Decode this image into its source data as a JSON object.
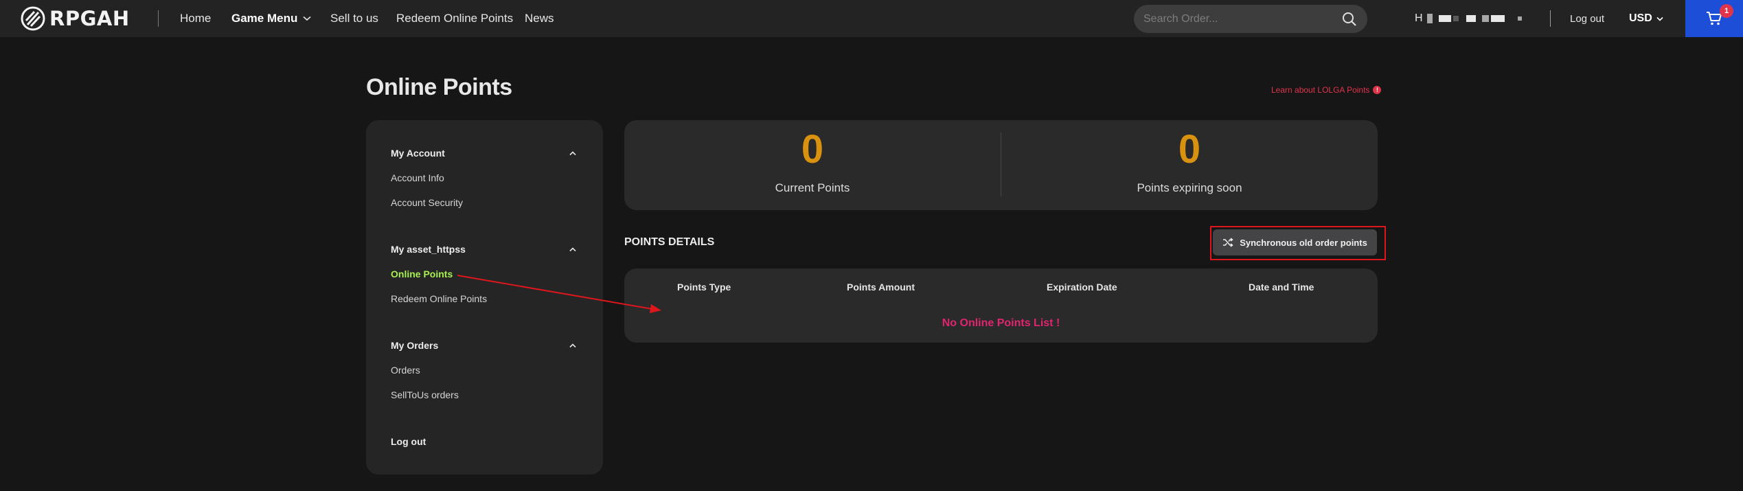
{
  "topbar": {
    "logo_text": "RPGAH",
    "nav": [
      {
        "label": "Home"
      },
      {
        "label": "Game Menu"
      },
      {
        "label": "Sell to us"
      },
      {
        "label": "Redeem Online Points"
      },
      {
        "label": "News"
      }
    ],
    "search_placeholder": "Search Order...",
    "user_initial": "H",
    "logout_label": "Log out",
    "currency": "USD",
    "cart_count": "1"
  },
  "page": {
    "title": "Online Points",
    "learn_link": "Learn about LOLGA Points",
    "learn_icon": "!"
  },
  "sidebar": {
    "groups": [
      {
        "title": "My Account",
        "items": [
          "Account Info",
          "Account Security"
        ]
      },
      {
        "title": "My asset_httpss",
        "items": [
          "Online Points",
          "Redeem Online Points"
        ]
      },
      {
        "title": "My Orders",
        "items": [
          "Orders",
          "SellToUs orders"
        ]
      }
    ],
    "active_item": "Online Points",
    "logout_label": "Log out"
  },
  "stats": {
    "current_points": "0",
    "current_points_label": "Current Points",
    "expiring_points": "0",
    "expiring_points_label": "Points expiring soon"
  },
  "details": {
    "title": "POINTS DETAILS",
    "sync_label": "Synchronous old order points",
    "columns": [
      "Points Type",
      "Points Amount",
      "Expiration Date",
      "Date and Time"
    ],
    "empty_message": "No Online Points List !"
  },
  "colors": {
    "accent_points": "#d9920f",
    "active_nav": "#a8f050",
    "danger": "#e0344a",
    "cart": "#1d4ed8",
    "annotation": "#e0161d"
  },
  "icons": {
    "logo": "rpgah-logo-icon",
    "search": "search-icon",
    "cart": "cart-icon",
    "sync": "shuffle-icon"
  }
}
